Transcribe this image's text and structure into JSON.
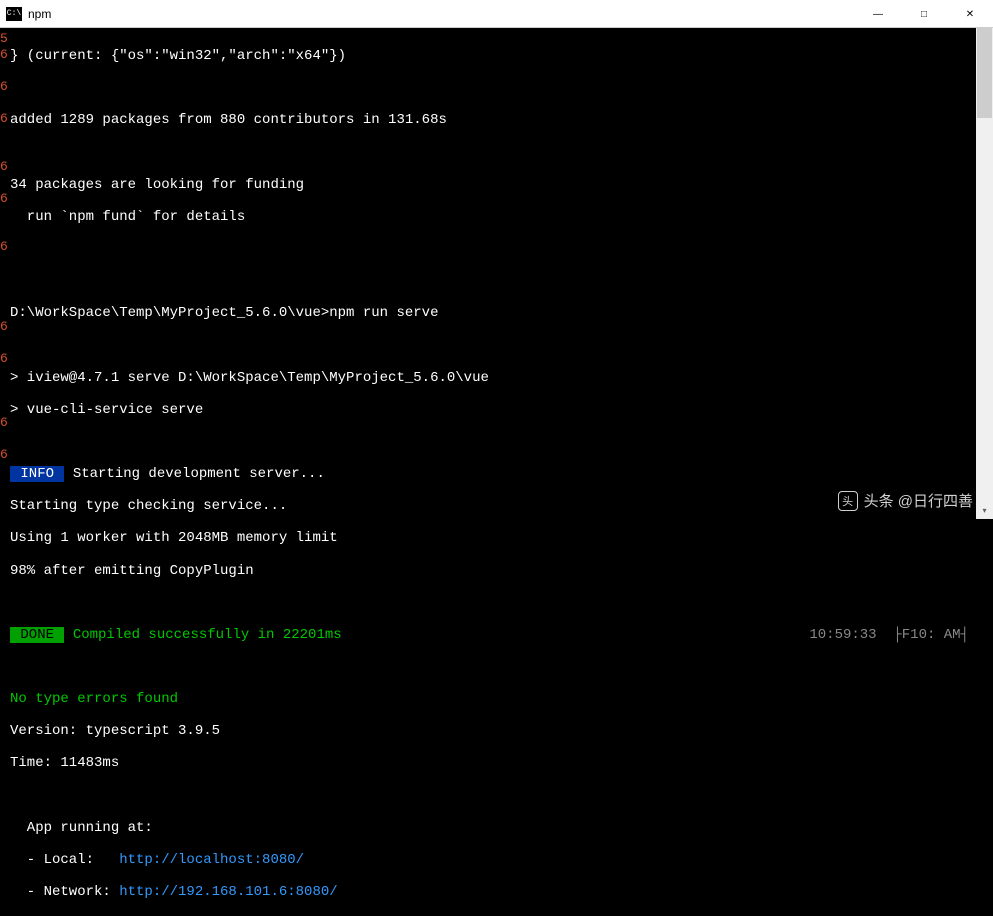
{
  "window": {
    "icon_text": "C:\\",
    "title": "npm"
  },
  "left_markers": [
    "5",
    "6",
    "",
    "6",
    "",
    "6",
    "",
    "",
    "6",
    "",
    "6",
    "",
    "",
    "6",
    "",
    "",
    "",
    "",
    "6",
    "",
    "6",
    "",
    "",
    "",
    "6",
    "",
    "6"
  ],
  "terminal": {
    "l1": "} (current: {\"os\":\"win32\",\"arch\":\"x64\"})",
    "l2": "",
    "l3": "added 1289 packages from 880 contributors in 131.68s",
    "l4": "",
    "l5": "34 packages are looking for funding",
    "l6": "  run `npm fund` for details",
    "l7": "",
    "l8": "",
    "l9": "D:\\WorkSpace\\Temp\\MyProject_5.6.0\\vue>npm run serve",
    "l10": "",
    "l11": "> iview@4.7.1 serve D:\\WorkSpace\\Temp\\MyProject_5.6.0\\vue",
    "l12": "> vue-cli-service serve",
    "l13": "",
    "info_label": " INFO ",
    "l14": " Starting development server...",
    "l15": "Starting type checking service...",
    "l16": "Using 1 worker with 2048MB memory limit",
    "l17": "98% after emitting CopyPlugin",
    "l18": "",
    "done_label": " DONE ",
    "l19": " Compiled successfully in 22201ms",
    "time_right": "10:59:33  ├F10: AM┤",
    "l20": "",
    "l21": "No type errors found",
    "l22": "Version: typescript 3.9.5",
    "l23": "Time: 11483ms",
    "l24": "",
    "l25": "  App running at:",
    "l26a": "  - Local:   ",
    "l26b": "http://localhost:8080/",
    "l27a": "  - Network: ",
    "l27b": "http://192.168.101.6:8080/"
  },
  "watermark": {
    "icon": "头",
    "text": "头条 @日行四善"
  }
}
